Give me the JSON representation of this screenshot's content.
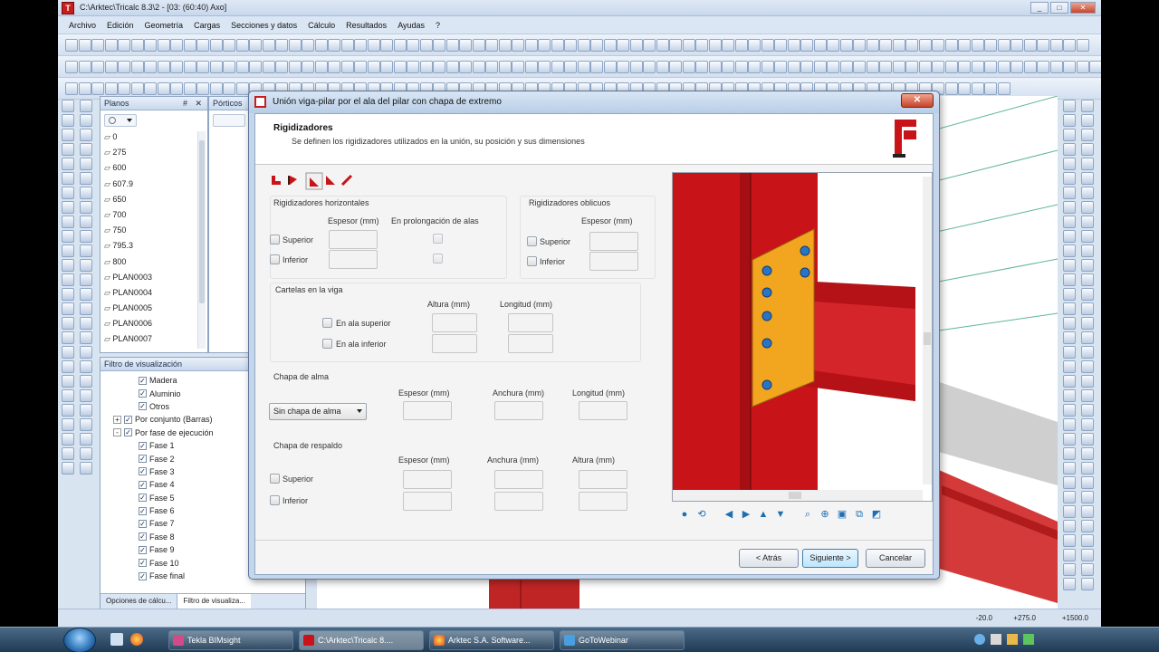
{
  "window": {
    "title": "C:\\Arktec\\Tricalc 8.3\\2 - [03:  (60:40)  Axo]",
    "min": "_",
    "max": "□",
    "close": "✕"
  },
  "menu": [
    "Archivo",
    "Edición",
    "Geometría",
    "Cargas",
    "Secciones y datos",
    "Cálculo",
    "Resultados",
    "Ayudas",
    "?"
  ],
  "planos": {
    "header": "Planos",
    "pin": "#",
    "close": "✕",
    "items": [
      "0",
      "275",
      "600",
      "607.9",
      "650",
      "700",
      "750",
      "795.3",
      "800",
      "PLAN0003",
      "PLAN0004",
      "PLAN0005",
      "PLAN0006",
      "PLAN0007"
    ]
  },
  "porticos": {
    "header": "Pórticos"
  },
  "filtro": {
    "header": "Filtro de visualización",
    "items": [
      {
        "label": "Madera",
        "level": 2,
        "checked": true
      },
      {
        "label": "Aluminio",
        "level": 2,
        "checked": true
      },
      {
        "label": "Otros",
        "level": 2,
        "checked": true
      },
      {
        "label": "Por conjunto (Barras)",
        "level": 1,
        "checked": true,
        "expander": "+"
      },
      {
        "label": "Por fase de ejecución",
        "level": 1,
        "checked": true,
        "expander": "-"
      },
      {
        "label": "Fase 1",
        "level": 2,
        "checked": true
      },
      {
        "label": "Fase 2",
        "level": 2,
        "checked": true
      },
      {
        "label": "Fase 3",
        "level": 2,
        "checked": true
      },
      {
        "label": "Fase 4",
        "level": 2,
        "checked": true
      },
      {
        "label": "Fase 5",
        "level": 2,
        "checked": true
      },
      {
        "label": "Fase 6",
        "level": 2,
        "checked": true
      },
      {
        "label": "Fase 7",
        "level": 2,
        "checked": true
      },
      {
        "label": "Fase 8",
        "level": 2,
        "checked": true
      },
      {
        "label": "Fase 9",
        "level": 2,
        "checked": true
      },
      {
        "label": "Fase 10",
        "level": 2,
        "checked": true
      },
      {
        "label": "Fase final",
        "level": 2,
        "checked": true
      }
    ],
    "tabs": [
      "Opciones de cálcu...",
      "Filtro de visualiza..."
    ]
  },
  "dialog": {
    "title": "Unión viga-pilar por el ala del pilar con chapa de extremo",
    "close": "✕",
    "section_title": "Rigidizadores",
    "section_desc": "Se definen los rigidizadores utilizados en la unión, su posición y sus dimensiones",
    "horizontales": {
      "title": "Rigidizadores horizontales",
      "espesor": "Espesor (mm)",
      "prolongacion": "En prolongación de alas",
      "superior": "Superior",
      "inferior": "Inferior"
    },
    "oblicuos": {
      "title": "Rigidizadores oblicuos",
      "espesor": "Espesor (mm)",
      "superior": "Superior",
      "inferior": "Inferior"
    },
    "cartelas": {
      "title": "Cartelas en la viga",
      "altura": "Altura (mm)",
      "longitud": "Longitud (mm)",
      "superior": "En ala superior",
      "inferior": "En ala inferior"
    },
    "alma": {
      "title": "Chapa de alma",
      "select": "Sin chapa de alma",
      "espesor": "Espesor (mm)",
      "anchura": "Anchura (mm)",
      "longitud": "Longitud (mm)"
    },
    "respaldo": {
      "title": "Chapa de respaldo",
      "espesor": "Espesor (mm)",
      "anchura": "Anchura (mm)",
      "altura": "Altura (mm)",
      "superior": "Superior",
      "inferior": "Inferior"
    },
    "buttons": {
      "back": "< Atrás",
      "next": "Siguiente >",
      "cancel": "Cancelar"
    }
  },
  "status": {
    "coord1": "-20.0",
    "coord2": "+275.0",
    "coord3": "+1500.0"
  },
  "taskbar": {
    "items": [
      "Tekla BIMsight",
      "C:\\Arktec\\Tricalc 8....",
      "Arktec S.A. Software...",
      "GoToWebinar"
    ]
  },
  "colors": {
    "beam": "#c81418",
    "plate": "#f2a51e",
    "bolt": "#2a74c8"
  }
}
